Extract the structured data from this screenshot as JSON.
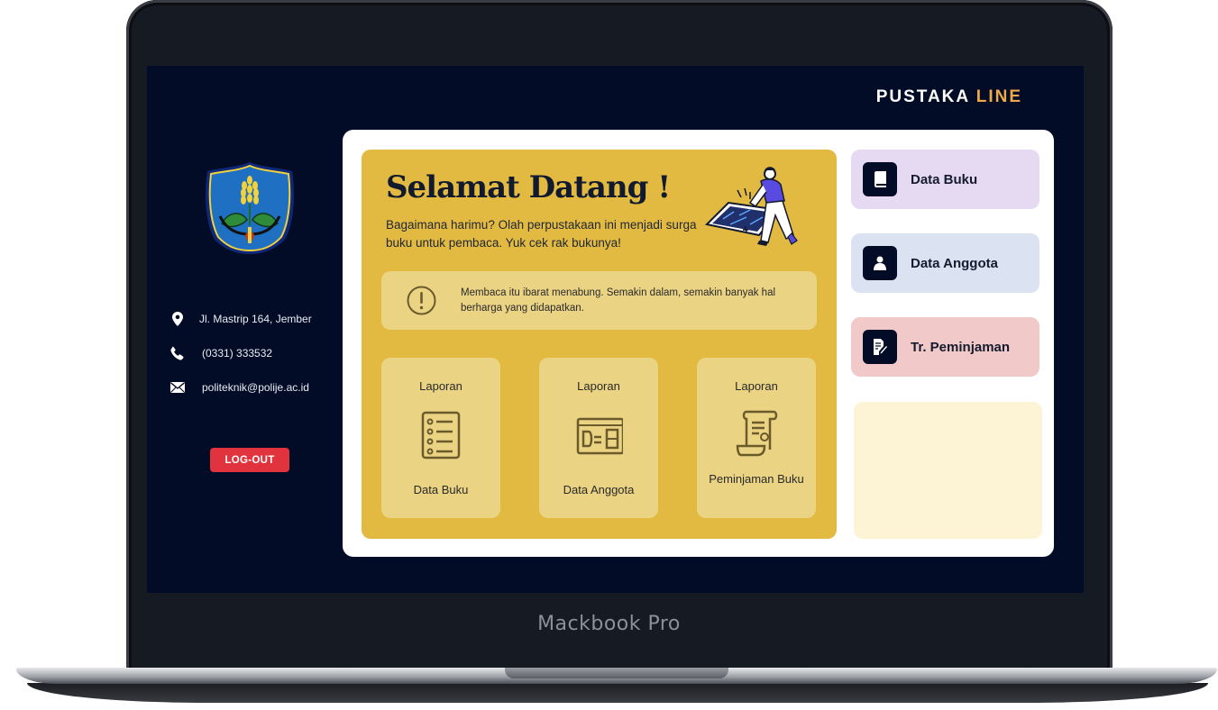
{
  "device": {
    "label": "Mackbook Pro"
  },
  "brand": {
    "name": "PUSTAKA",
    "accent": "LINE",
    "accent_color": "#f0a94a"
  },
  "sidebar": {
    "contacts": [
      {
        "icon": "location-pin-icon",
        "text": "Jl. Mastrip 164, Jember"
      },
      {
        "icon": "phone-icon",
        "text": "(0331) 333532"
      },
      {
        "icon": "mail-icon",
        "text": "politeknik@polije.ac.id"
      }
    ],
    "logout_label": "LOG-OUT"
  },
  "welcome": {
    "title": "Selamat Datang !",
    "subtitle": "Bagaimana harimu? Olah perpustakaan ini menjadi surga buku untuk pembaca. Yuk cek rak bukunya!",
    "quote": "Membaca itu ibarat menabung. Semakin dalam, semakin banyak hal berharga yang didapatkan."
  },
  "reports": [
    {
      "title": "Laporan",
      "label": "Data Buku",
      "icon": "book-list-icon"
    },
    {
      "title": "Laporan",
      "label": "Data Anggota",
      "icon": "id-card-icon"
    },
    {
      "title": "Laporan",
      "label": "Peminjaman Buku",
      "icon": "scroll-receipt-icon"
    }
  ],
  "menu": [
    {
      "label": "Data Buku",
      "icon": "book-icon",
      "color": "#e6d9f2"
    },
    {
      "label": "Data Anggota",
      "icon": "user-icon",
      "color": "#dbe3f3"
    },
    {
      "label": "Tr. Peminjaman",
      "icon": "edit-document-icon",
      "color": "#f2c9c9"
    }
  ],
  "colors": {
    "screen_bg": "#020c26",
    "welcome_panel": "#e3ba41",
    "card_tint": "#ebd384",
    "logout": "#e0333d",
    "info_panel": "#fdf4d6"
  }
}
